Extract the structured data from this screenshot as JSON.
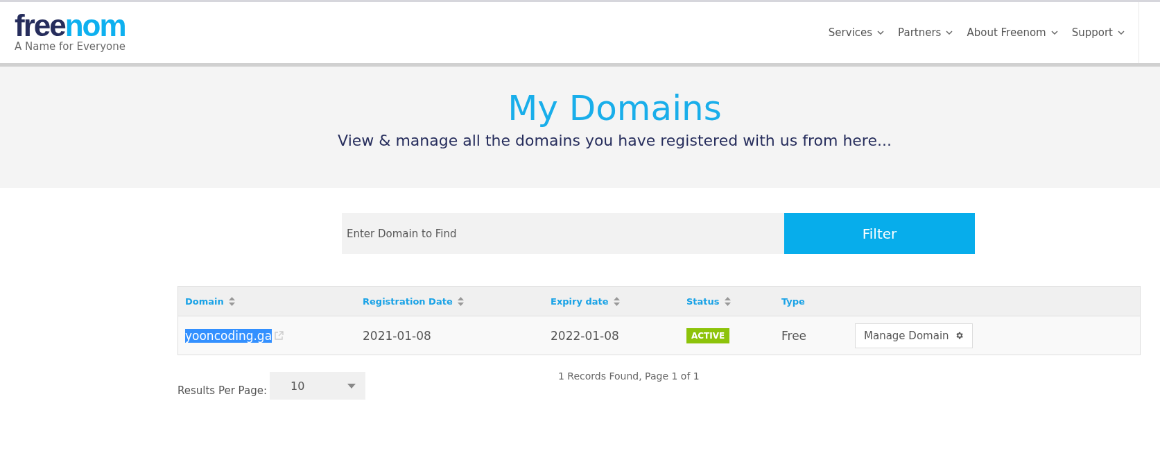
{
  "logo": {
    "dark_part": "free",
    "light_part": "nom",
    "tagline": "A Name for Everyone"
  },
  "nav": [
    {
      "label": "Services"
    },
    {
      "label": "Partners"
    },
    {
      "label": "About Freenom"
    },
    {
      "label": "Support"
    }
  ],
  "hero": {
    "title": "My Domains",
    "subtitle": "View & manage all the domains you have registered with us from here..."
  },
  "search": {
    "placeholder": "Enter Domain to Find",
    "button": "Filter"
  },
  "table": {
    "columns": [
      {
        "label": "Domain",
        "sortable": true
      },
      {
        "label": "Registration Date",
        "sortable": true
      },
      {
        "label": "Expiry date",
        "sortable": true
      },
      {
        "label": "Status",
        "sortable": true
      },
      {
        "label": "Type",
        "sortable": false
      }
    ],
    "rows": [
      {
        "domain": "yooncoding.ga",
        "selected": true,
        "registration_date": "2021-01-08",
        "expiry_date": "2022-01-08",
        "status": "ACTIVE",
        "type": "Free",
        "action": "Manage Domain"
      }
    ]
  },
  "results_per_page": {
    "label": "Results Per Page:",
    "value": "10"
  },
  "records": "1 Records Found, Page 1 of 1"
}
